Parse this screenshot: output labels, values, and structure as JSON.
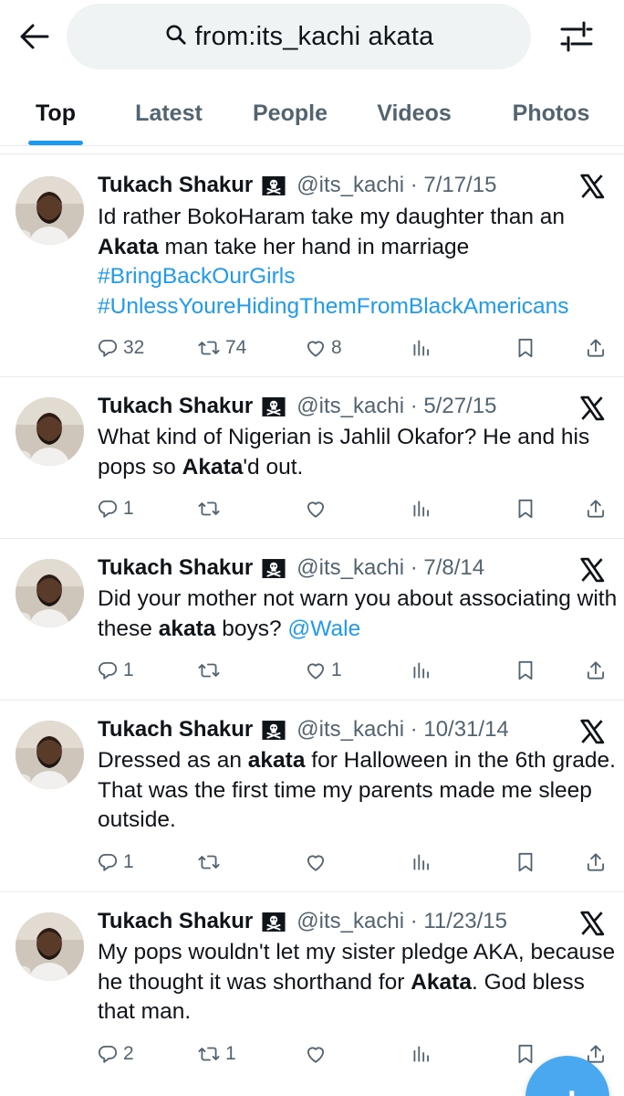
{
  "header": {
    "back_icon": "arrow-left-icon",
    "search_icon": "search-icon",
    "search_query": "from:its_kachi akata",
    "filter_icon": "sliders-icon"
  },
  "tabs": [
    {
      "label": "Top",
      "active": true
    },
    {
      "label": "Latest",
      "active": false
    },
    {
      "label": "People",
      "active": false
    },
    {
      "label": "Videos",
      "active": false
    },
    {
      "label": "Photos",
      "active": false
    }
  ],
  "accent_color": "#1d9bf0",
  "tweets": [
    {
      "name": "Tukach Shakur",
      "flag_icon": "pirate-flag-icon",
      "handle_date": "@its_kachi · 7/17/15",
      "text_parts": [
        "Id rather BokoHaram take my daughter than an ",
        "Akata",
        " man take her hand in marriage"
      ],
      "hashtags": [
        "#BringBackOurGirls",
        "#UnlessYoureHidingThemFromBlackAmericans"
      ],
      "replies": "32",
      "retweets": "74",
      "likes": "8"
    },
    {
      "name": "Tukach Shakur",
      "flag_icon": "pirate-flag-icon",
      "handle_date": "@its_kachi · 5/27/15",
      "text_parts": [
        "What kind of Nigerian is Jahlil Okafor? He and his pops so ",
        "Akata",
        "'d out."
      ],
      "replies": "1",
      "retweets": "",
      "likes": ""
    },
    {
      "name": "Tukach Shakur",
      "flag_icon": "pirate-flag-icon",
      "handle_date": "@its_kachi · 7/8/14",
      "text_parts": [
        "Did your mother not warn you about associating with these ",
        "akata",
        " boys? "
      ],
      "mention": "@Wale",
      "replies": "1",
      "retweets": "",
      "likes": "1"
    },
    {
      "name": "Tukach Shakur",
      "flag_icon": "pirate-flag-icon",
      "handle_date": "@its_kachi · 10/31/14",
      "text_parts": [
        "Dressed as an ",
        "akata",
        " for Halloween in the 6th grade. That was the first time my parents made me sleep outside."
      ],
      "replies": "1",
      "retweets": "",
      "likes": ""
    },
    {
      "name": "Tukach Shakur",
      "flag_icon": "pirate-flag-icon",
      "handle_date": "@its_kachi · 11/23/15",
      "text_parts": [
        "My pops wouldn't let my sister pledge AKA, because he thought it was shorthand for ",
        "Akata",
        ". God bless that man."
      ],
      "replies": "2",
      "retweets": "1",
      "likes": ""
    }
  ],
  "fab_icon": "compose-plus-icon"
}
